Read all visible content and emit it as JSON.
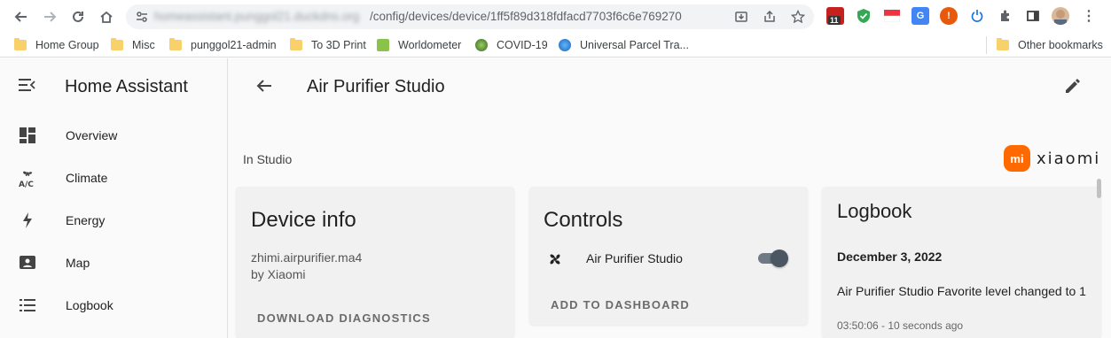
{
  "browser": {
    "url_host": "homeassistant.punggol21.duckdns.org",
    "url_path": "/config/devices/device/1ff5f89d318fdfacd7703f6c6e769270",
    "extension_badge": "11",
    "bookmarks": [
      {
        "label": "Home Group",
        "type": "folder"
      },
      {
        "label": "Misc",
        "type": "folder"
      },
      {
        "label": "punggol21-admin",
        "type": "folder"
      },
      {
        "label": "To 3D Print",
        "type": "folder"
      },
      {
        "label": "Worldometer",
        "type": "site"
      },
      {
        "label": "COVID-19",
        "type": "site"
      },
      {
        "label": "Universal Parcel Tra...",
        "type": "site"
      }
    ],
    "other_bookmarks": "Other bookmarks"
  },
  "sidebar": {
    "title": "Home Assistant",
    "items": [
      {
        "label": "Overview",
        "icon": "dashboard-icon"
      },
      {
        "label": "Climate",
        "icon": "fan-ac-icon"
      },
      {
        "label": "Energy",
        "icon": "lightning-icon"
      },
      {
        "label": "Map",
        "icon": "map-icon"
      },
      {
        "label": "Logbook",
        "icon": "list-icon"
      }
    ]
  },
  "header": {
    "title": "Air Purifier Studio"
  },
  "device": {
    "area": "In Studio",
    "brand": "xiaomi",
    "brand_logo_text": "mi"
  },
  "device_info": {
    "heading": "Device info",
    "model": "zhimi.airpurifier.ma4",
    "manufacturer": "by Xiaomi",
    "download_label": "DOWNLOAD DIAGNOSTICS"
  },
  "controls": {
    "heading": "Controls",
    "entity_name": "Air Purifier Studio",
    "toggle_on": true,
    "add_label": "ADD TO DASHBOARD"
  },
  "logbook": {
    "heading": "Logbook",
    "date": "December 3, 2022",
    "message": "Air Purifier Studio Favorite level changed to 1",
    "time": "03:50:06 - 10 seconds ago"
  },
  "colors": {
    "xiaomi_orange": "#ff6900",
    "toggle_on": "#4b5663"
  }
}
